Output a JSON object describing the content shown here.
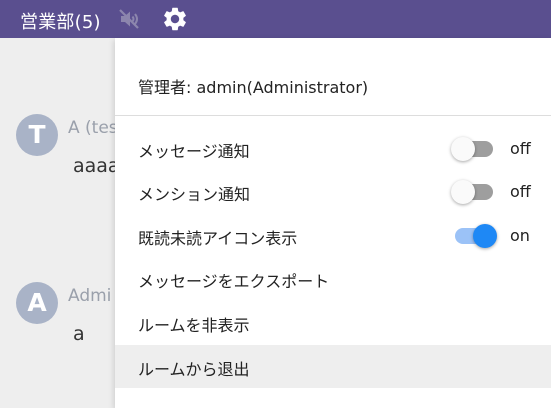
{
  "header": {
    "title": "営業部(5)",
    "mute_icon": "bell-off-icon",
    "settings_icon": "gear-icon"
  },
  "chat": {
    "messages": [
      {
        "avatar_letter": "T",
        "author": "A (tes",
        "text": "aaaa"
      },
      {
        "avatar_letter": "A",
        "author": "Admi",
        "text": "a"
      }
    ]
  },
  "menu": {
    "admin_text": "管理者: admin(Administrator)",
    "items": [
      {
        "label": "メッセージ通知",
        "state": "off"
      },
      {
        "label": "メンション通知",
        "state": "off"
      },
      {
        "label": "既読未読アイコン表示",
        "state": "on"
      },
      {
        "label": "メッセージをエクスポート"
      },
      {
        "label": "ルームを非表示"
      },
      {
        "label": "ルームから退出"
      }
    ]
  },
  "colors": {
    "header_bg": "#5a4f8f",
    "toggle_on": "#1e88f5",
    "toggle_off": "#9e9e9e"
  }
}
